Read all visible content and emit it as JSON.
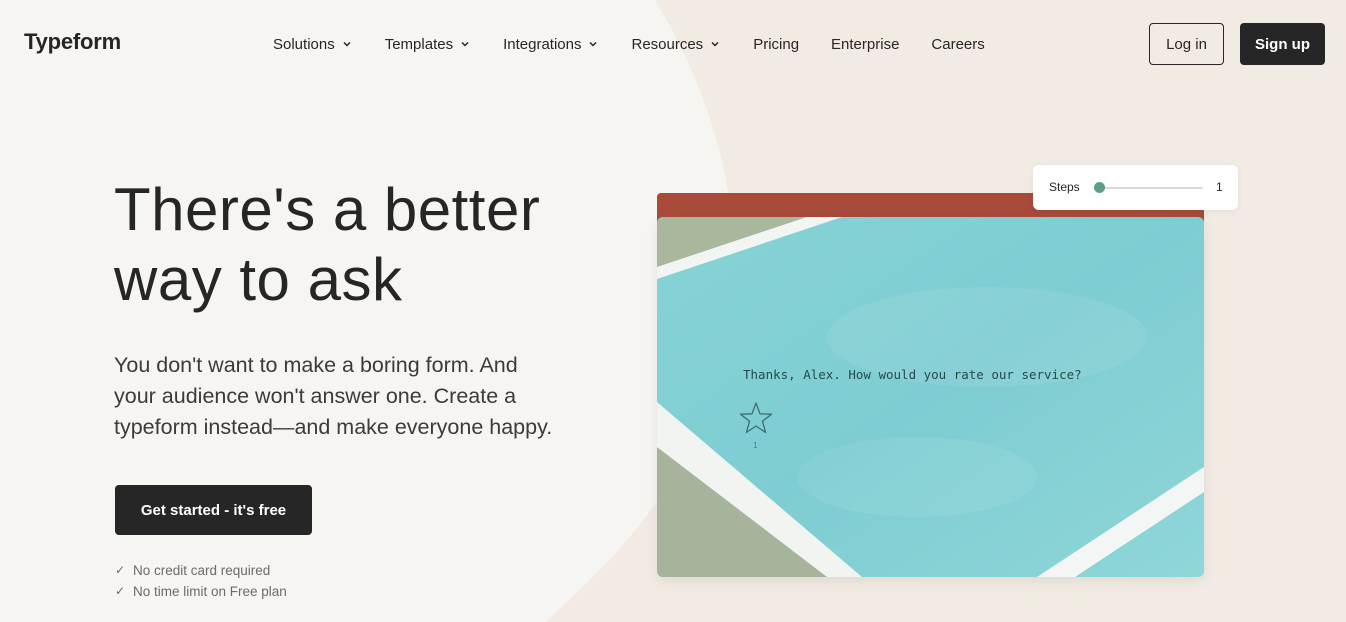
{
  "brand": {
    "logo": "Typeform"
  },
  "nav": {
    "items": [
      {
        "label": "Solutions",
        "has_dropdown": true
      },
      {
        "label": "Templates",
        "has_dropdown": true
      },
      {
        "label": "Integrations",
        "has_dropdown": true
      },
      {
        "label": "Resources",
        "has_dropdown": true
      },
      {
        "label": "Pricing",
        "has_dropdown": false
      },
      {
        "label": "Enterprise",
        "has_dropdown": false
      },
      {
        "label": "Careers",
        "has_dropdown": false
      }
    ],
    "login_label": "Log in",
    "signup_label": "Sign up"
  },
  "hero": {
    "title_line1": "There's a better",
    "title_line2": "way to ask",
    "subtitle_line1": "You don't want to make a boring form. And",
    "subtitle_line2": "your audience won't answer one. Create a",
    "subtitle_line3": "typeform instead—and make everyone happy.",
    "cta_label": "Get started - it's free",
    "checks": [
      "No credit card required",
      "No time limit on Free plan"
    ],
    "check_icon": "checkmark-icon"
  },
  "preview": {
    "question": "Thanks, Alex. How would you rate our service?",
    "rating_icon": "star-icon",
    "rating_label": "1",
    "steps_label": "Steps",
    "steps_value": "1",
    "steps_fraction": 0
  },
  "colors": {
    "ink": "#262627",
    "page_bg": "#f7f5f1",
    "blob_bg": "#f2ebe4",
    "card_top": "#a94b3b",
    "card_turquoise": "#7ccfd3",
    "card_olive": "#a9b79d",
    "slider_accent": "#5e9d8a"
  }
}
